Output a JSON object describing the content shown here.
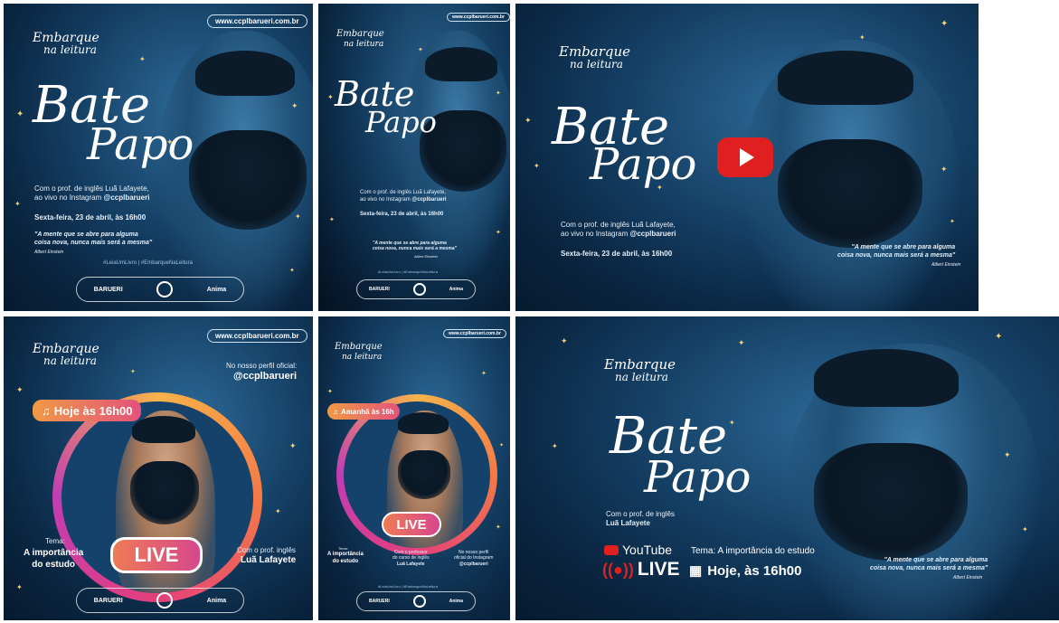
{
  "url": "www.ccplbarueri.com.br",
  "embarque": "Embarque",
  "na_leitura": "na leitura",
  "bate": "Bate",
  "papo": "Papo",
  "p1": {
    "line1": "Com o prof. de inglês Luã Lafayete,",
    "line2": "ao vivo no",
    "instagram": "Instagram",
    "handle": "@ccplbarueri",
    "date": "Sexta-feira, 23 de abril, às 16h00",
    "quote1": "\"A mente que se abre para alguma",
    "quote2": "coisa nova, nunca mais será a mesma\"",
    "author": "Albert Einstein",
    "hashtags": "#LeiaUmLivro | #EmbarqueNaLeitura"
  },
  "p2": {
    "line1": "Com o prof. de inglês Luã Lafayete,",
    "line2": "ao vivo no",
    "instagram": "Instagram",
    "handle": "@ccplbarueri",
    "date": "Sexta-feira, 23 de abril, às 16h00",
    "quote1": "\"A mente que se abre para alguma",
    "quote2": "coisa nova, nunca mais será a mesma\"",
    "author": "Albert Einstein",
    "hashtags": "#LeiaUmLivro | #EmbarqueNaLeitura"
  },
  "p3": {
    "line1": "Com o prof. de inglês Luã Lafayete,",
    "line2": "ao vivo no",
    "instagram": "Instagram",
    "handle": "@ccplbarueri",
    "date": "Sexta-feira, 23 de abril, às 16h00",
    "quote1": "\"A mente que se abre para alguma",
    "quote2": "coisa nova, nunca mais será a mesma\"",
    "author": "Albert Einstein"
  },
  "p4": {
    "profile_label": "No nosso perfil oficial:",
    "handle": "@ccplbarueri",
    "badge": "Hoje às 16h00",
    "live": "LIVE",
    "tema_label": "Tema:",
    "tema1": "A importância",
    "tema2": "do estudo",
    "prof_label": "Com o prof. inglês",
    "prof_name": "Luã Lafayete"
  },
  "p5": {
    "badge": "Amanhã às 16h",
    "live": "LIVE",
    "tema_label": "Tema:",
    "tema1": "A importância",
    "tema2": "do estudo",
    "prof_label1": "Com o professor",
    "prof_label2": "do curso de inglês",
    "prof_name": "Luã Lafayete",
    "profile_label1": "No nosso perfil",
    "profile_label2": "oficial do Instagram",
    "handle": "@ccplbarueri",
    "hashtags": "#LeiaUmLivro | #EmbarqueNaLeitura"
  },
  "p6": {
    "line1": "Com o prof. de inglês",
    "name": "Luã Lafayete",
    "youtube": "YouTube",
    "live": "LIVE",
    "tema_label": "Tema:",
    "tema": "A importância do estudo",
    "when": "Hoje, às 16h00",
    "quote1": "\"A mente que se abre para alguma",
    "quote2": "coisa nova, nunca mais será a mesma\"",
    "author": "Albert Einstein"
  },
  "logos": {
    "barueri": "BARUERI",
    "anima": "Anima"
  },
  "colors": {
    "accent_gold": "#f3d37a",
    "gradient_orange": "#f09a45",
    "gradient_pink": "#e3527c",
    "youtube_red": "#e02020"
  }
}
